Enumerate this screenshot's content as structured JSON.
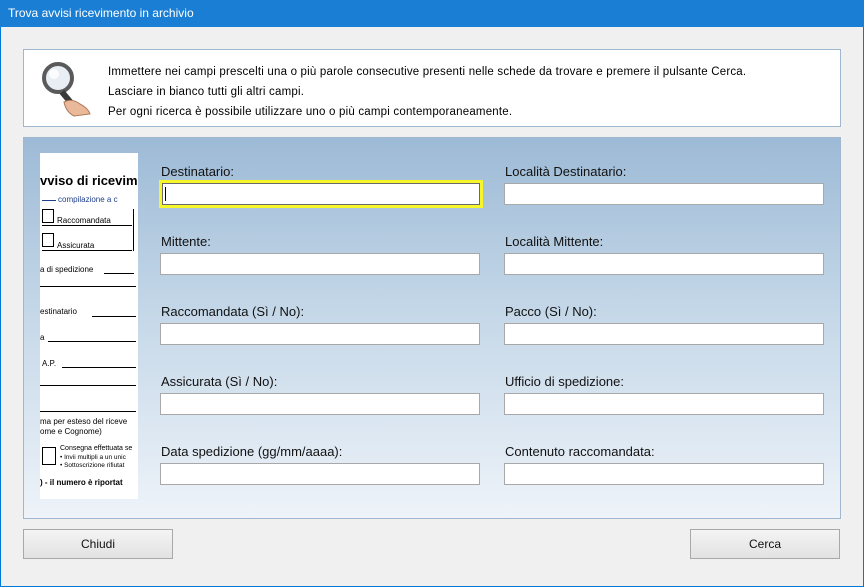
{
  "window": {
    "title": "Trova avvisi ricevimento in archivio"
  },
  "info": {
    "lines": [
      "Immettere nei campi prescelti una o più parole consecutive presenti nelle schede da trovare e premere il pulsante Cerca.",
      "Lasciare in bianco tutti gli altri campi.",
      "Per ogni ricerca è possibile utilizzare uno o più campi contemporaneamente."
    ]
  },
  "thumbnail": {
    "title": "vviso di ricevim",
    "subtitle": "compilazione a c",
    "raccomandata": "Raccomandata",
    "assicurata": "Assicurata",
    "spedizione": "a di spedizione",
    "destinatario": "estinatario",
    "a": "a",
    "cap": "A.P.",
    "firma1": "ma per esteso del riceve",
    "firma2": "ome e Cognome)",
    "consegna": "Consegna effettuata se",
    "invii": "• Invii multipli a un unic",
    "sottoscrizione": "• Sottoscrizione rifiutat",
    "numero": ") - il numero è riportat"
  },
  "fields": {
    "destinatario": {
      "label": "Destinatario:",
      "value": ""
    },
    "localita_destinatario": {
      "label": "Località Destinatario:",
      "value": ""
    },
    "mittente": {
      "label": "Mittente:",
      "value": ""
    },
    "localita_mittente": {
      "label": "Località Mittente:",
      "value": ""
    },
    "raccomandata": {
      "label": "Raccomandata (Sì / No):",
      "value": ""
    },
    "pacco": {
      "label": "Pacco (Sì / No):",
      "value": ""
    },
    "assicurata": {
      "label": "Assicurata (Sì / No):",
      "value": ""
    },
    "ufficio_spedizione": {
      "label": "Ufficio di spedizione:",
      "value": ""
    },
    "data_spedizione": {
      "label": "Data spedizione (gg/mm/aaaa):",
      "value": ""
    },
    "contenuto_raccomandata": {
      "label": "Contenuto raccomandata:",
      "value": ""
    }
  },
  "buttons": {
    "close": "Chiudi",
    "search": "Cerca"
  },
  "colors": {
    "titlebar": "#1a7fd4",
    "focus_border": "#f6f62a"
  }
}
